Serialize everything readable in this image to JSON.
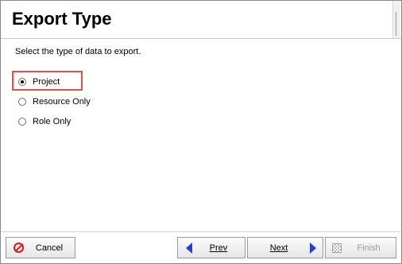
{
  "header": {
    "title": "Export Type"
  },
  "main": {
    "instruction": "Select the type of data to export.",
    "options": [
      {
        "label": "Project",
        "selected": true
      },
      {
        "label": "Resource Only",
        "selected": false
      },
      {
        "label": "Role Only",
        "selected": false
      }
    ]
  },
  "footer": {
    "cancel_label": "Cancel",
    "prev_label": "Prev",
    "next_label": "Next",
    "finish_label": "Finish",
    "finish_enabled": false
  },
  "colors": {
    "highlight": "#e05050",
    "nav_arrow": "#1f43d0",
    "cancel_icon": "#d8161c"
  }
}
